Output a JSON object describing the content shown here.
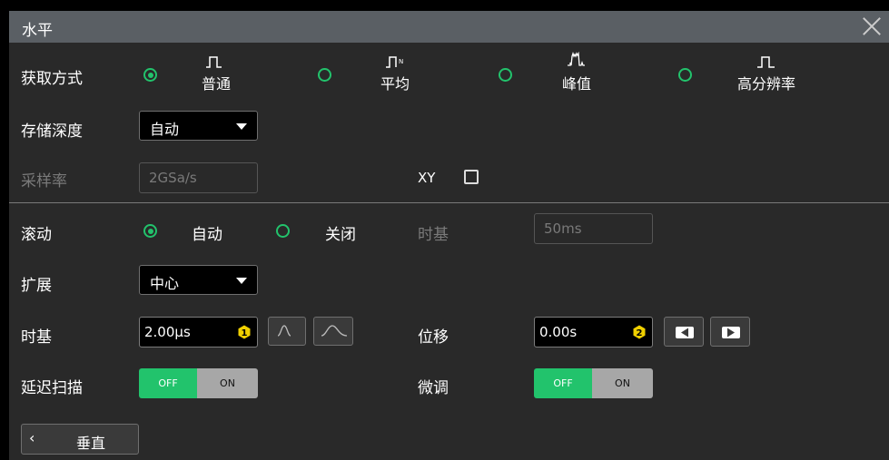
{
  "window": {
    "title": "水平"
  },
  "acquire": {
    "label": "获取方式",
    "options": [
      {
        "label": "普通",
        "selected": true
      },
      {
        "label": "平均",
        "selected": false
      },
      {
        "label": "峰值",
        "selected": false
      },
      {
        "label": "高分辨率",
        "selected": false
      }
    ]
  },
  "memory_depth": {
    "label": "存储深度",
    "value": "自动"
  },
  "sample_rate": {
    "label": "采样率",
    "value": "2GSa/s"
  },
  "xy": {
    "label": "XY",
    "checked": false
  },
  "roll": {
    "label": "滚动",
    "options": [
      {
        "label": "自动",
        "selected": true
      },
      {
        "label": "关闭",
        "selected": false
      }
    ],
    "timebase_label": "时基",
    "timebase_value": "50ms"
  },
  "expand": {
    "label": "扩展",
    "value": "中心"
  },
  "timebase": {
    "label": "时基",
    "value": "2.00µs",
    "knob": "1"
  },
  "offset": {
    "label": "位移",
    "value": "0.00s",
    "knob": "2"
  },
  "delayed_sweep": {
    "label": "延迟扫描",
    "off": "OFF",
    "on": "ON"
  },
  "fine": {
    "label": "微调",
    "off": "OFF",
    "on": "ON"
  },
  "back_button": {
    "label": "垂直"
  },
  "colors": {
    "accent": "#22c36c",
    "knob": "#f0d000",
    "title_bar": "#5a5f64",
    "panel": "#292929"
  }
}
